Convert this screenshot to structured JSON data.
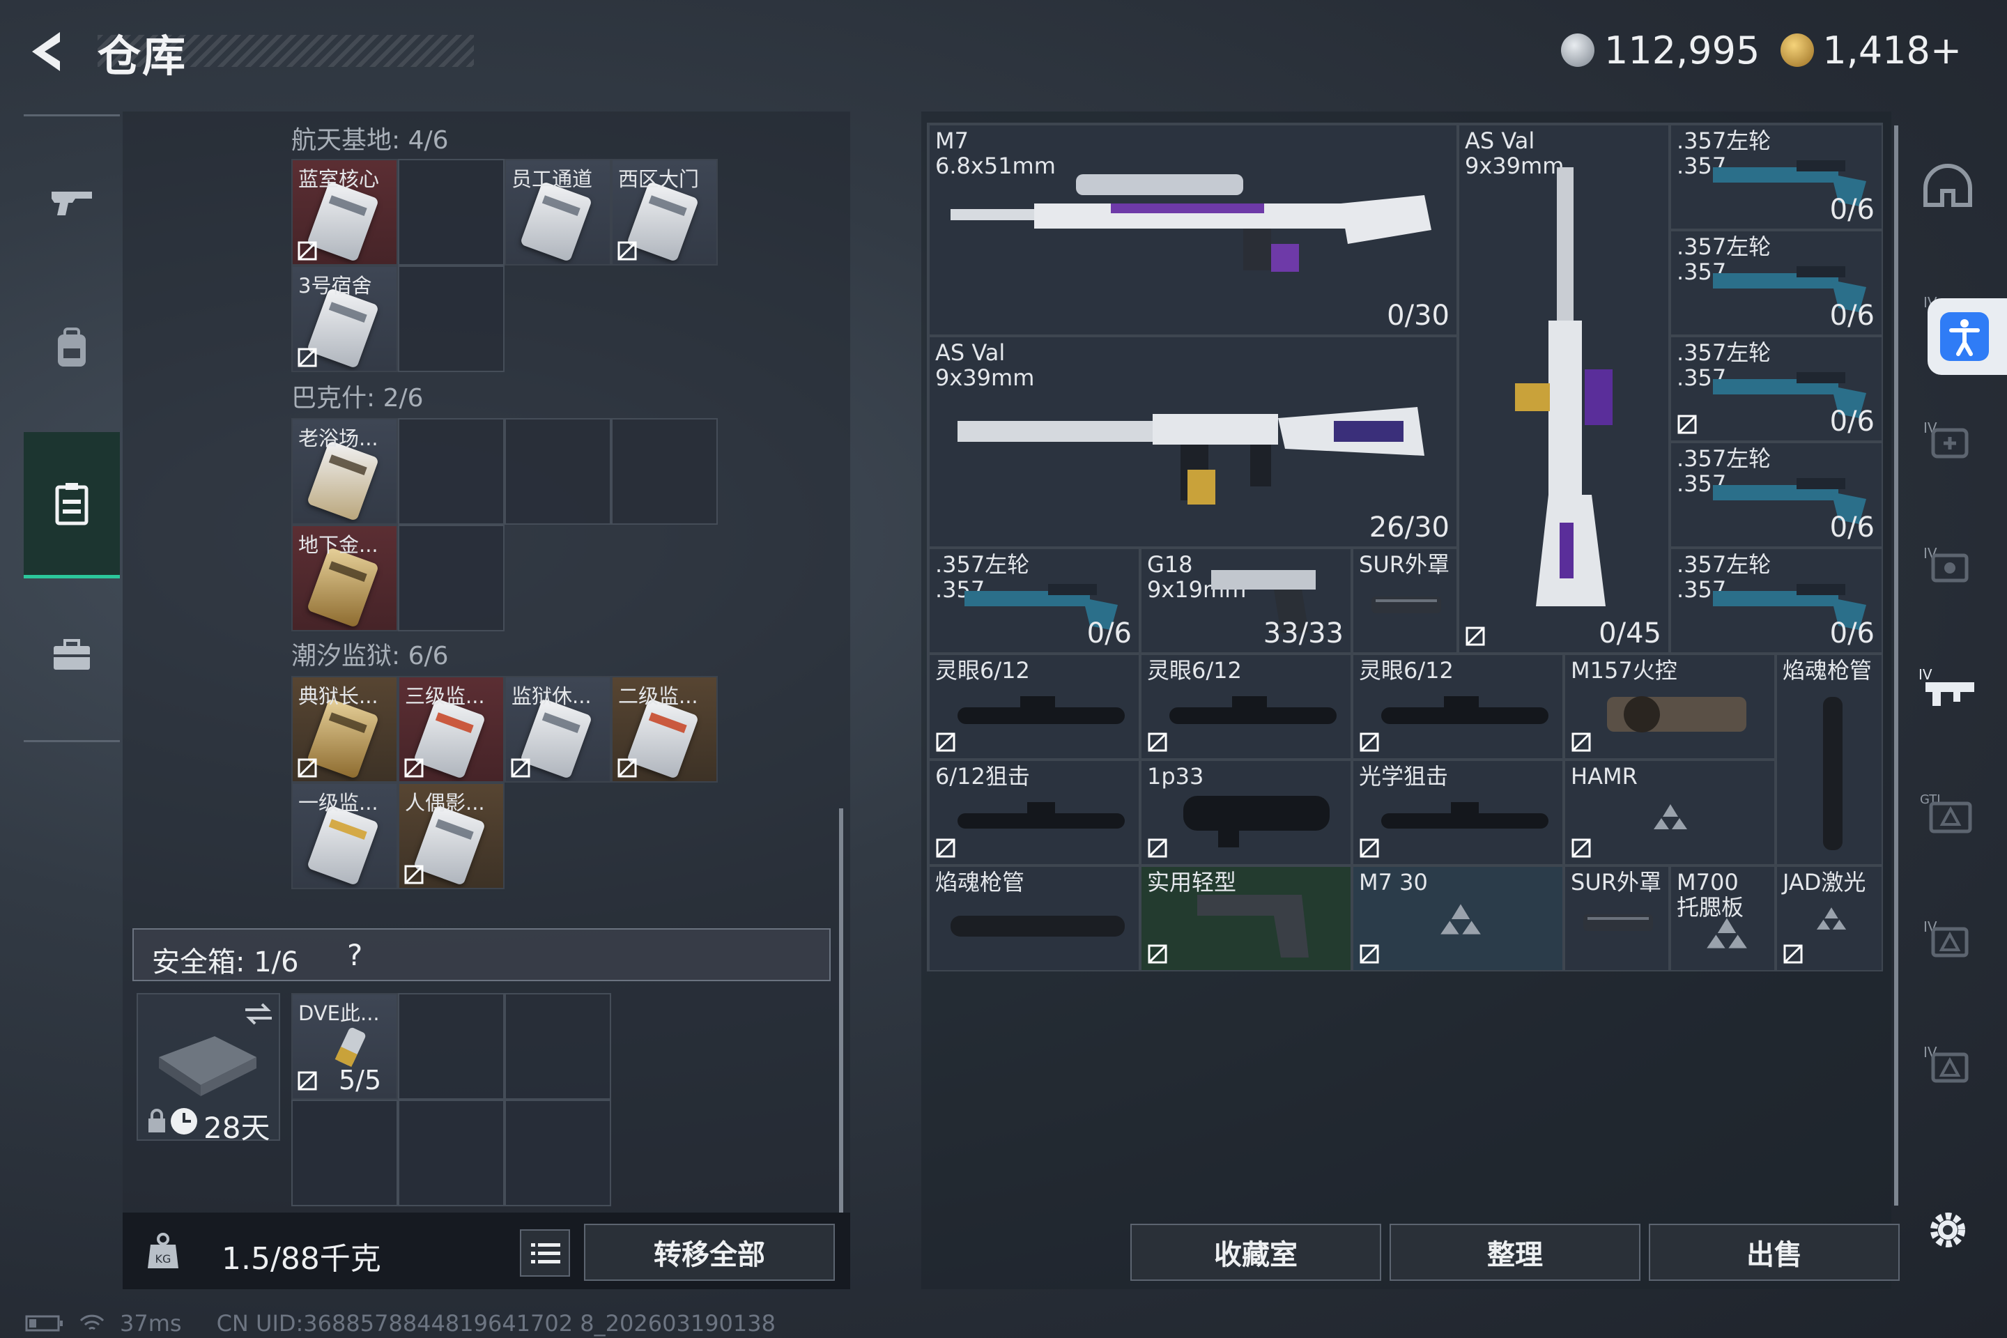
{
  "header": {
    "title": "仓库",
    "currency1": "112,995",
    "currency2": "1,418+"
  },
  "nav": [
    "weapon-icon",
    "backpack-icon",
    "storage-icon",
    "briefcase-icon"
  ],
  "keycards": {
    "sections": [
      {
        "title": "航天基地: 4/6",
        "items": [
          "蓝室核心",
          "员工通道",
          "西区大门",
          "3号宿舍"
        ]
      },
      {
        "title": "巴克什: 2/6",
        "items": [
          "老浴场...",
          "地下金..."
        ]
      },
      {
        "title": "潮汐监狱: 6/6",
        "items": [
          "典狱长...",
          "三级监...",
          "监狱休...",
          "二级监...",
          "一级监...",
          "人偶影..."
        ]
      }
    ]
  },
  "safe": {
    "label": "安全箱: 1/6",
    "help": "?",
    "days": "28天",
    "item_label": "DVE此...",
    "item_count": "5/5"
  },
  "bottom": {
    "weight": "1.5/88千克",
    "transfer": "转移全部"
  },
  "grid": {
    "m7": {
      "name": "M7\n6.8x51mm",
      "count": "0/30"
    },
    "asval1": {
      "name": "AS Val\n9x39mm",
      "count": "26/30"
    },
    "asval2": {
      "name": "AS Val\n9x39mm",
      "count": "0/45"
    },
    "rev": [
      {
        "name": ".357左轮\n.357",
        "count": "0/6"
      },
      {
        "name": ".357左轮\n.357",
        "count": "0/6"
      },
      {
        "name": ".357左轮\n.357",
        "count": "0/6"
      },
      {
        "name": ".357左轮\n.357",
        "count": "0/6"
      },
      {
        "name": ".357左轮\n.357",
        "count": "0/6"
      },
      {
        "name": ".357左轮\n.357",
        "count": "0/6"
      }
    ],
    "g18": {
      "name": "G18\n9x19mm",
      "count": "33/33"
    },
    "sur1": {
      "name": "SUR外罩"
    },
    "row_a": [
      "灵眼6/12",
      "灵眼6/12",
      "灵眼6/12",
      "M157火控",
      "焰魂枪管"
    ],
    "row_b": [
      "6/12狙击",
      "1p33",
      "光学狙击",
      "HAMR"
    ],
    "row_c": [
      "焰魂枪管",
      "实用轻型",
      "M7 30",
      "SUR外罩",
      "M700\n托腮板",
      "JAD激光"
    ]
  },
  "actions": {
    "collection": "收藏室",
    "sort": "整理",
    "sell": "出售"
  },
  "status": {
    "ping": "37ms",
    "uid": "CN UID:3688578844819641702 8_202603190138"
  },
  "right_tabs": [
    "helmet-icon",
    "armor-iv-icon",
    "backpack-iv-icon",
    "rig-iv-icon",
    "weapon-iv-icon",
    "gti-icon",
    "case-iv-icon",
    "case-iv-icon-2"
  ],
  "colors": {
    "accent": "#2cc79b",
    "redcell": "#5b2e33",
    "goldcell": "#574532"
  }
}
